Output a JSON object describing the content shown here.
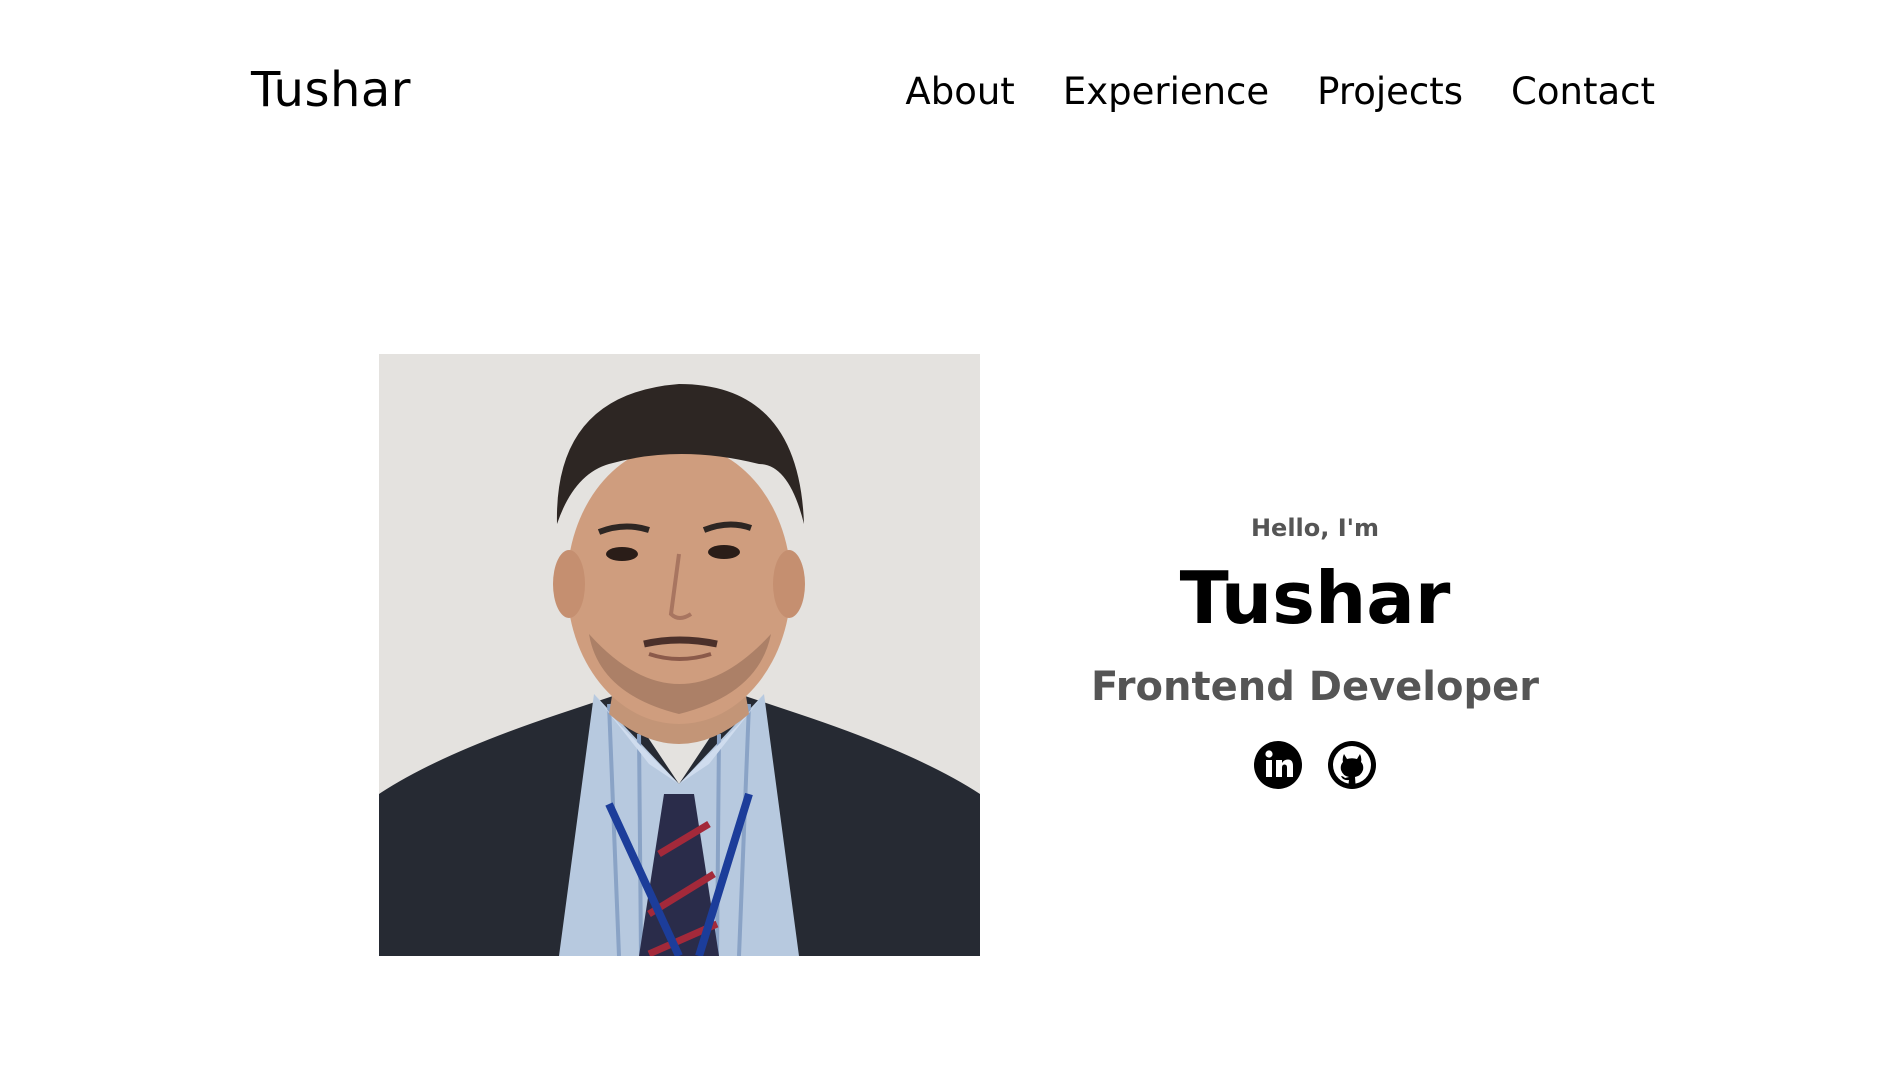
{
  "nav": {
    "logo": "Tushar",
    "links": [
      {
        "label": "About"
      },
      {
        "label": "Experience"
      },
      {
        "label": "Projects"
      },
      {
        "label": "Contact"
      }
    ]
  },
  "profile": {
    "greeting": "Hello, I'm",
    "name": "Tushar",
    "role": "Frontend Developer",
    "socials": [
      {
        "icon": "linkedin-icon"
      },
      {
        "icon": "github-icon"
      }
    ]
  },
  "colors": {
    "text": "#000000",
    "muted": "#555555",
    "background": "#ffffff",
    "photo_background": "#e4e2df"
  }
}
